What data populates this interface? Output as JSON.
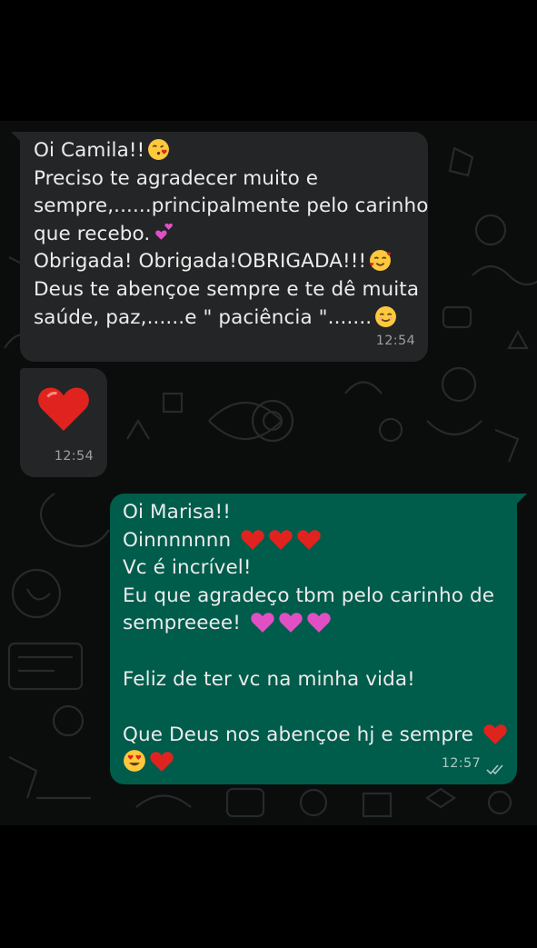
{
  "colors": {
    "background": "#000000",
    "chat_wallpaper": "#0b0c0c",
    "incoming_bubble": "#232526",
    "outgoing_bubble": "#005c4b",
    "text": "#ececec",
    "heart_red": "#e0231f",
    "heart_pink": "#e24fc4"
  },
  "messages": [
    {
      "direction": "incoming",
      "lines": [
        {
          "text": "Oi Camila!!",
          "emoji": [
            "kissing-face-with-heart-icon"
          ]
        },
        {
          "text": "Preciso te agradecer muito e"
        },
        {
          "text": "sempre,......principalmente pelo carinho"
        },
        {
          "text": "que recebo.",
          "emoji": [
            "two-hearts-icon"
          ]
        },
        {
          "text": "Obrigada! Obrigada!OBRIGADA!!!",
          "emoji": [
            "smiling-face-with-hearts-icon"
          ]
        },
        {
          "text": "Deus te abençoe sempre e te dê muita"
        },
        {
          "text": "saúde, paz,......e \" paciência \".......",
          "emoji": [
            "smiling-face-icon"
          ]
        }
      ],
      "time": "12:54"
    },
    {
      "direction": "incoming",
      "emoji_only": "red-heart-icon",
      "time": "12:54"
    },
    {
      "direction": "outgoing",
      "lines": [
        {
          "text": "Oi Marisa!!"
        },
        {
          "text": "Oinnnnnnn",
          "emoji": [
            "red-heart-icon",
            "red-heart-icon",
            "red-heart-icon"
          ]
        },
        {
          "text": "Vc é incrível!"
        },
        {
          "text": "Eu que agradeço tbm pelo carinho de"
        },
        {
          "text": "sempreeee!",
          "emoji": [
            "pink-heart-icon",
            "pink-heart-icon",
            "pink-heart-icon"
          ]
        },
        {
          "text": ""
        },
        {
          "text": "Feliz de ter vc na minha vida!"
        },
        {
          "text": ""
        },
        {
          "text": "Que Deus nos abençoe hj e sempre",
          "emoji": [
            "red-heart-icon"
          ]
        },
        {
          "text": "",
          "emoji": [
            "heart-eyes-face-icon",
            "red-heart-icon"
          ]
        }
      ],
      "time": "12:57",
      "status": "read-double-check-icon"
    }
  ]
}
